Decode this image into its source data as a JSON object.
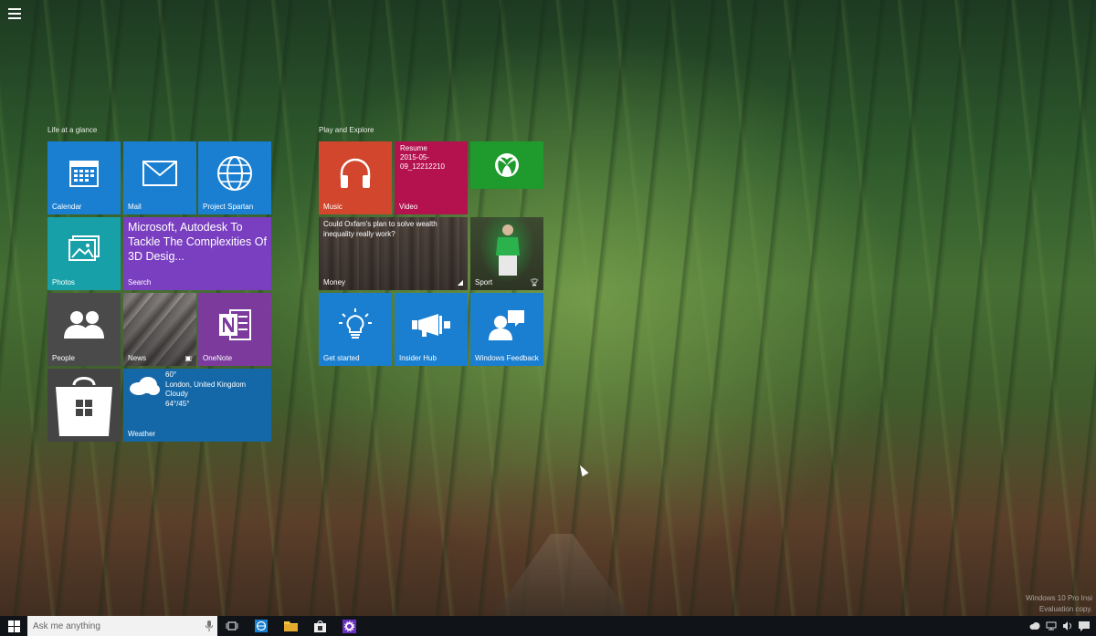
{
  "start": {
    "menu_icon": "hamburger-icon",
    "groups": [
      {
        "title": "Life at a glance"
      },
      {
        "title": "Play and Explore"
      }
    ],
    "tiles": {
      "calendar": {
        "label": "Calendar",
        "icon": "calendar-icon"
      },
      "mail": {
        "label": "Mail",
        "icon": "mail-icon"
      },
      "spartan": {
        "label": "Project Spartan",
        "icon": "globe-icon"
      },
      "photos": {
        "label": "Photos",
        "icon": "photos-icon"
      },
      "search": {
        "label": "Search",
        "headline": "Microsoft, Autodesk To Tackle The Complexities Of 3D Desig..."
      },
      "people": {
        "label": "People",
        "icon": "people-icon"
      },
      "news": {
        "label": "News"
      },
      "onenote": {
        "label": "OneNote",
        "icon": "onenote-icon"
      },
      "store": {
        "icon": "store-icon"
      },
      "weather": {
        "label": "Weather",
        "temp": "60°",
        "location": "London, United Kingdom",
        "condition": "Cloudy",
        "range": "64°/45°"
      },
      "music": {
        "label": "Music",
        "icon": "headphones-icon"
      },
      "video": {
        "label": "Video",
        "line1": "Resume",
        "line2": "2015-05-09_12212210"
      },
      "xbox": {
        "icon": "xbox-icon"
      },
      "money": {
        "label": "Money",
        "headline": "Could Oxfam's plan to solve wealth inequality really work?"
      },
      "sport": {
        "label": "Sport"
      },
      "get_started": {
        "label": "Get started",
        "icon": "lightbulb-icon"
      },
      "insider_hub": {
        "label": "Insider Hub",
        "icon": "megaphone-icon"
      },
      "windows_feedback": {
        "label": "Windows Feedback",
        "icon": "feedback-icon"
      }
    }
  },
  "taskbar": {
    "search_placeholder": "Ask me anything",
    "apps": [
      "task-view-icon",
      "edge-icon",
      "file-explorer-icon",
      "store-icon",
      "settings-icon"
    ]
  },
  "watermark": {
    "line1": "Windows 10 Pro Insi",
    "line2": "Evaluation copy."
  },
  "colors": {
    "accent_blue": "#1a7fd0",
    "teal": "#17a0a8",
    "purple": "#7a3fc0",
    "music_red": "#d1462c",
    "video_magenta": "#b4124f",
    "xbox_green": "#1f9a2c"
  }
}
